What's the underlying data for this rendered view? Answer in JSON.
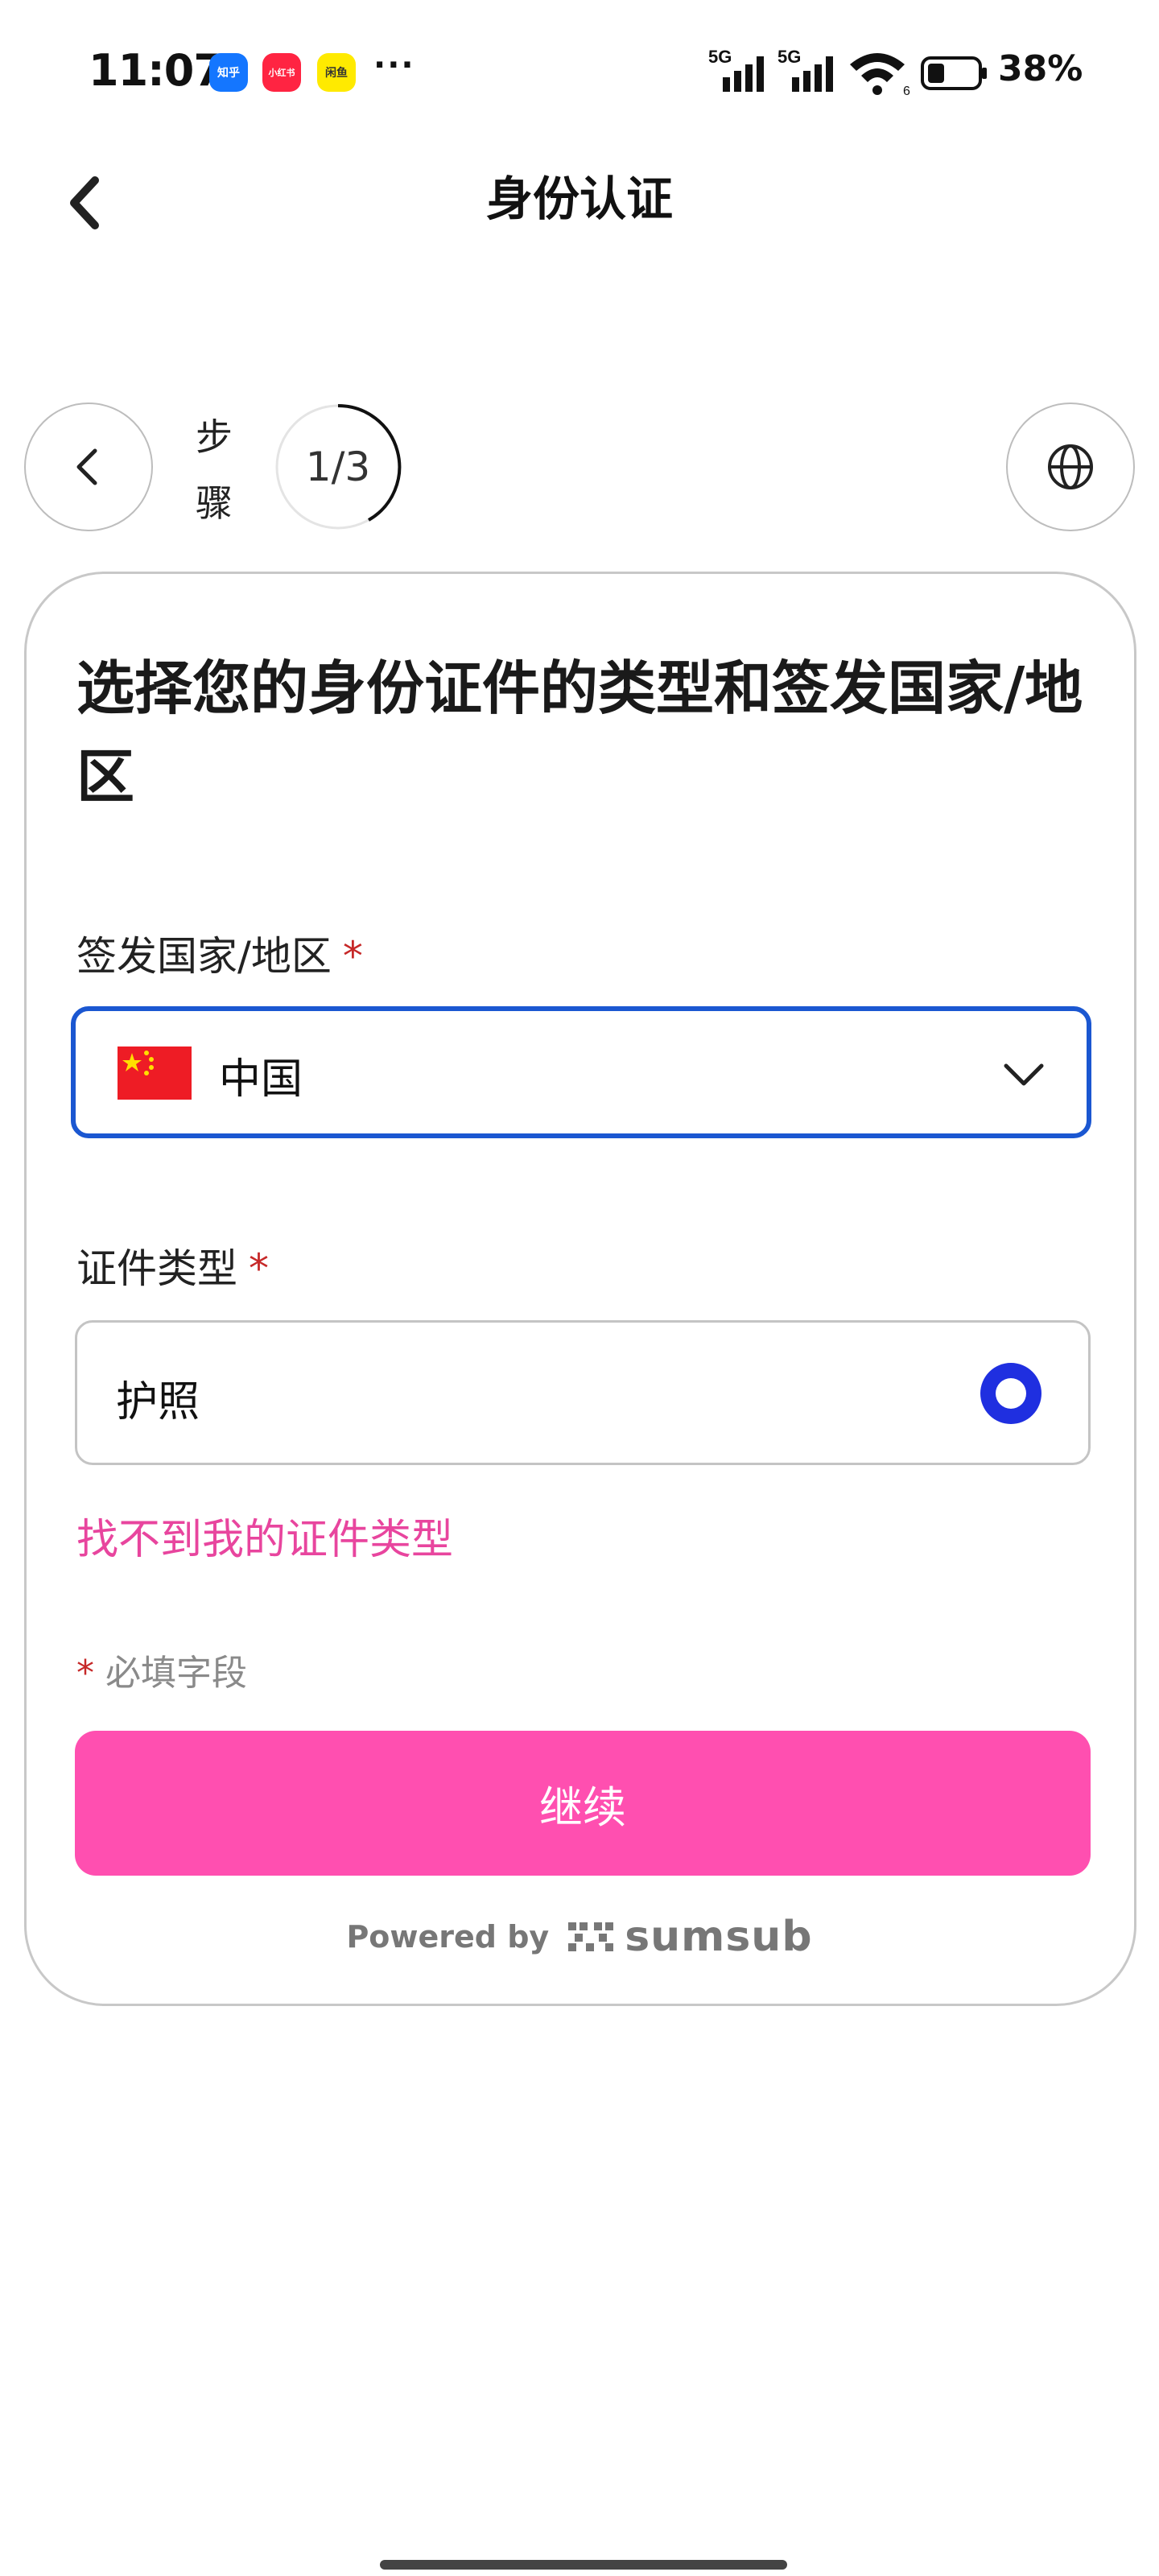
{
  "status_bar": {
    "time": "11:07",
    "apps": [
      {
        "name": "zhihu-icon",
        "label": "知乎",
        "color": "#1476ff"
      },
      {
        "name": "xiaohongshu-icon",
        "label": "小红书",
        "color": "#ff2442"
      },
      {
        "name": "xianyu-icon",
        "label": "闲鱼",
        "color": "#ffea00"
      }
    ],
    "more": "···",
    "network": [
      "5G",
      "5G"
    ],
    "battery_percent": "38%"
  },
  "header": {
    "title": "身份认证"
  },
  "steps": {
    "label": "步骤",
    "current": "1",
    "total": "3",
    "counter_text": "1/3",
    "progress": 0.33
  },
  "card": {
    "title": "选择您的身份证件的类型和签发国家/地区",
    "country_field": {
      "label": "签发国家/地区",
      "required_mark": "*",
      "value": "中国"
    },
    "doc_type_field": {
      "label": "证件类型",
      "required_mark": "*",
      "selected_option": "护照"
    },
    "missing_doc_link": "找不到我的证件类型",
    "required_note": {
      "mark": "*",
      "text": "必填字段"
    },
    "continue_button": "继续",
    "powered_by": {
      "prefix": "Powered by",
      "brand": "sumsub"
    }
  },
  "colors": {
    "accent_pink": "#ff4fb0",
    "link_pink": "#e8459e",
    "focus_blue": "#1b57d1",
    "radio_blue": "#1f2fe0",
    "required_red": "#c62828"
  }
}
